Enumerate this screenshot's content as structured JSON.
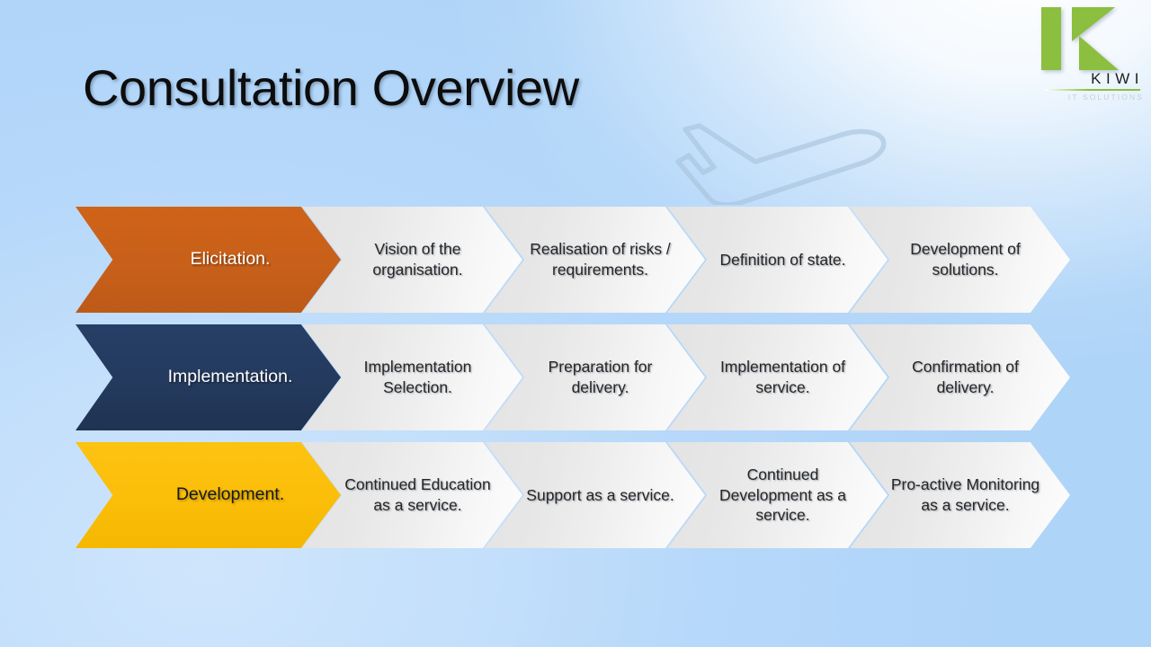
{
  "slide": {
    "title": "Consultation Overview",
    "background_top_left": "#a9d2f8",
    "background_bottom_left": "#cfe5fc",
    "background_highlight": "#ffffff"
  },
  "logo": {
    "name": "KIWI",
    "tagline": "IT SOLUTIONS",
    "mark_color": "#8cbe3f",
    "wordmark_color": "#1d1d1b",
    "tagline_color": "#c6cfd6"
  },
  "decoration": {
    "airplane_label": "airplane-outline",
    "airplane_color": "#a8c3dd"
  },
  "rows": [
    {
      "lead": {
        "label": "Elicitation.",
        "color": "#c8601a",
        "text_color": "#ffffff"
      },
      "steps": [
        {
          "label": "Vision of the organisation."
        },
        {
          "label": "Realisation of risks / requirements."
        },
        {
          "label": "Definition of state."
        },
        {
          "label": "Development of solutions."
        }
      ]
    },
    {
      "lead": {
        "label": "Implementation.",
        "color": "#243a5e",
        "text_color": "#ffffff"
      },
      "steps": [
        {
          "label": "Implementation Selection."
        },
        {
          "label": "Preparation for delivery."
        },
        {
          "label": "Implementation of service."
        },
        {
          "label": "Confirmation of delivery."
        }
      ]
    },
    {
      "lead": {
        "label": "Development.",
        "color": "#fbbe09",
        "text_color": "#171717"
      },
      "steps": [
        {
          "label": "Continued Education as a service."
        },
        {
          "label": "Support as a service."
        },
        {
          "label": "Continued Development as a service."
        },
        {
          "label": "Pro-active Monitoring as a service."
        }
      ]
    }
  ]
}
